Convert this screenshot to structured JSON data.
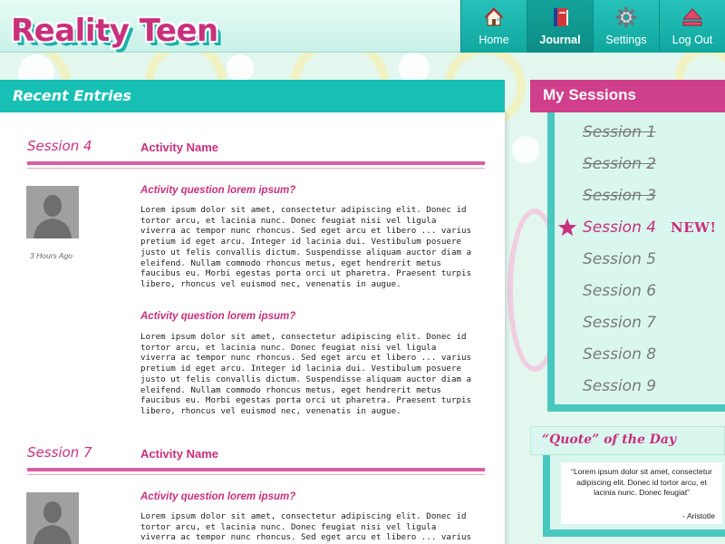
{
  "app": {
    "logo": "Reality Teen"
  },
  "nav": {
    "items": [
      {
        "label": "Home",
        "icon": "home-icon",
        "active": false
      },
      {
        "label": "Journal",
        "icon": "journal-icon",
        "active": true
      },
      {
        "label": "Settings",
        "icon": "gear-icon",
        "active": false
      },
      {
        "label": "Log Out",
        "icon": "eject-icon",
        "active": false
      }
    ]
  },
  "recent": {
    "title": "Recent Entries",
    "entries": [
      {
        "session": "Session 4",
        "activity": "Activity Name",
        "time_ago": "3 Hours Ago",
        "questions": [
          {
            "title": "Activity question lorem ipsum?",
            "body": "Lorem ipsum dolor sit amet, consectetur adipiscing elit. Donec id tortor arcu, et lacinia nunc. Donec feugiat nisi vel ligula viverra ac tempor nunc rhoncus. Sed eget arcu et libero ... varius pretium id eget arcu. Integer id lacinia dui. Vestibulum posuere justo ut felis convallis dictum. Suspendisse aliquam auctor diam a eleifend. Nullam commodo rhoncus metus, eget hendrerit metus faucibus eu. Morbi egestas porta orci ut pharetra. Praesent turpis libero, rhoncus vel euismod nec, venenatis in augue."
          },
          {
            "title": "Activity question lorem ipsum?",
            "body": "Lorem ipsum dolor sit amet, consectetur adipiscing elit. Donec id tortor arcu, et lacinia nunc. Donec feugiat nisi vel ligula viverra ac tempor nunc rhoncus. Sed eget arcu et libero ... varius pretium id eget arcu. Integer id lacinia dui. Vestibulum posuere justo ut felis convallis dictum. Suspendisse aliquam auctor diam a eleifend. Nullam commodo rhoncus metus, eget hendrerit metus faucibus eu. Morbi egestas porta orci ut pharetra. Praesent turpis libero, rhoncus vel euismod nec, venenatis in augue."
          }
        ]
      },
      {
        "session": "Session 7",
        "activity": "Activity Name",
        "questions": [
          {
            "title": "Activity question lorem ipsum?",
            "body": "Lorem ipsum dolor sit amet, consectetur adipiscing elit. Donec id tortor arcu, et lacinia nunc. Donec feugiat nisi vel ligula viverra ac tempor nunc rhoncus. Sed eget arcu et libero ... varius pretium id eget"
          }
        ]
      }
    ]
  },
  "sessions": {
    "title": "My Sessions",
    "new_label": "NEW!",
    "items": [
      {
        "label": "Session 1",
        "state": "done"
      },
      {
        "label": "Session 2",
        "state": "done"
      },
      {
        "label": "Session 3",
        "state": "done"
      },
      {
        "label": "Session 4",
        "state": "current"
      },
      {
        "label": "Session 5",
        "state": "upcoming"
      },
      {
        "label": "Session 6",
        "state": "upcoming"
      },
      {
        "label": "Session 7",
        "state": "upcoming"
      },
      {
        "label": "Session 8",
        "state": "upcoming"
      },
      {
        "label": "Session 9",
        "state": "upcoming"
      }
    ]
  },
  "quote": {
    "title": "“Quote” of the Day",
    "text": "“Lorem ipsum dolor sit amet, consectetur adipiscing elit. Donec id tortor arcu, et lacinia nunc. Donec feugiat”",
    "author": "- Aristotle"
  },
  "colors": {
    "teal": "#17bfb5",
    "pink": "#c8307c",
    "mint": "#d9f7ee"
  }
}
